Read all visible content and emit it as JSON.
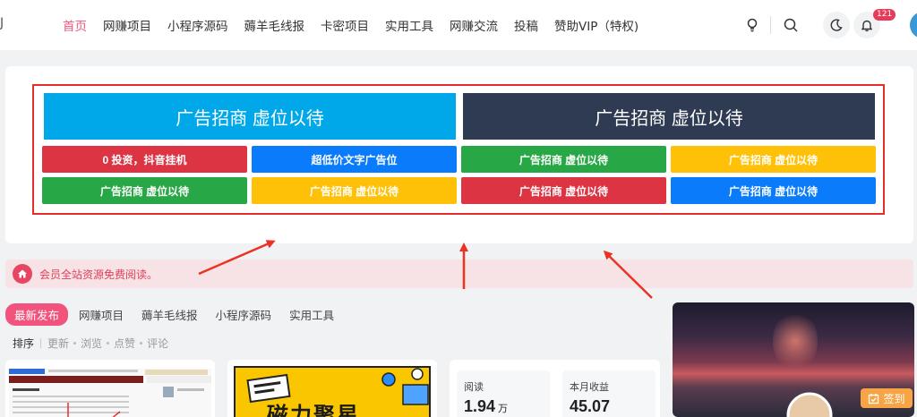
{
  "header": {
    "logo_fragment": "J",
    "nav": [
      "首页",
      "网赚项目",
      "小程序源码",
      "薅羊毛线报",
      "卡密项目",
      "实用工具",
      "网赚交流",
      "投稿",
      "赞助VIP（特权)"
    ],
    "active_index": 0,
    "notification_count": "121",
    "accent_color": "#f2537d"
  },
  "ads": {
    "big": [
      {
        "text": "广告招商 虚位以待",
        "color": "#00a8e9"
      },
      {
        "text": "广告招商 虚位以待",
        "color": "#2f3b52"
      }
    ],
    "small": [
      {
        "text": "0 投资，抖音挂机",
        "color": "#dd3444"
      },
      {
        "text": "超低价文字广告位",
        "color": "#0a7bfa"
      },
      {
        "text": "广告招商 虚位以待",
        "color": "#27a745"
      },
      {
        "text": "广告招商 虚位以待",
        "color": "#fec107"
      },
      {
        "text": "广告招商 虚位以待",
        "color": "#27a745"
      },
      {
        "text": "广告招商 虚位以待",
        "color": "#fec107"
      },
      {
        "text": "广告招商 虚位以待",
        "color": "#dd3444"
      },
      {
        "text": "广告招商 虚位以待",
        "color": "#0a7bfa"
      }
    ]
  },
  "notice": {
    "text": "会员全站资源免费阅读。",
    "icon": "home-icon"
  },
  "tabs": [
    "最新发布",
    "网赚项目",
    "薅羊毛线报",
    "小程序源码",
    "实用工具"
  ],
  "sort": {
    "label": "排序",
    "options": [
      "更新",
      "浏览",
      "点赞",
      "评论"
    ]
  },
  "post_thumb_text": "磁力聚星",
  "stats": [
    {
      "label": "阅读",
      "value": "1.94",
      "unit": "万"
    },
    {
      "label": "本月收益",
      "value": "45.07",
      "unit": ""
    }
  ],
  "signin_label": "签到"
}
